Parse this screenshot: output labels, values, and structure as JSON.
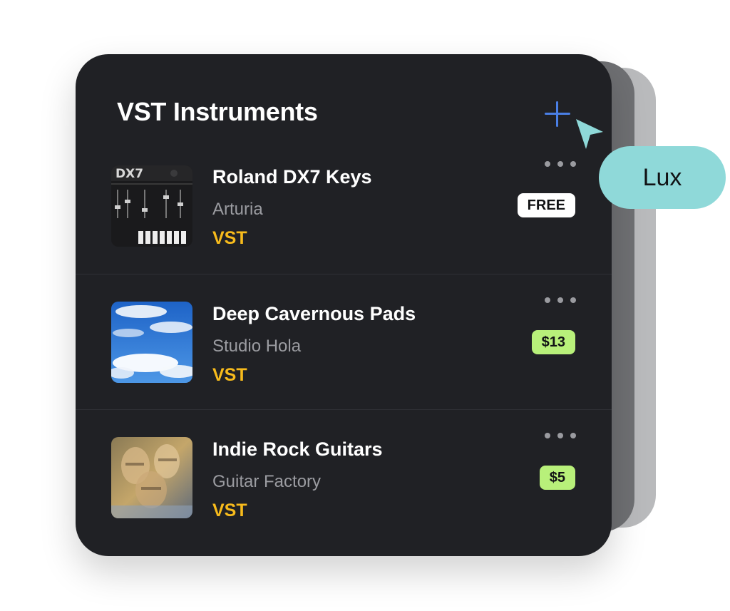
{
  "panel": {
    "title": "VST Instruments",
    "add_icon": "plus-icon",
    "more_icon": "more-horizontal-icon"
  },
  "items": [
    {
      "name": "Roland DX7 Keys",
      "vendor": "Arturia",
      "type": "VST",
      "price": "FREE",
      "thumbnail": "synthesizer-panel-image"
    },
    {
      "name": "Deep Cavernous Pads",
      "vendor": "Studio Hola",
      "type": "VST",
      "price": "$13",
      "thumbnail": "blue-sky-clouds-image"
    },
    {
      "name": "Indie Rock Guitars",
      "vendor": "Guitar Factory",
      "type": "VST",
      "price": "$5",
      "thumbnail": "blurred-faces-image"
    }
  ],
  "collaborator": {
    "name": "Lux",
    "color": "#8fd9d9"
  },
  "colors": {
    "card_background": "#202125",
    "accent_blue": "#4a7fe6",
    "type_label": "#f7bb1c",
    "paid_badge": "#b8f07a",
    "free_badge": "#ffffff"
  }
}
